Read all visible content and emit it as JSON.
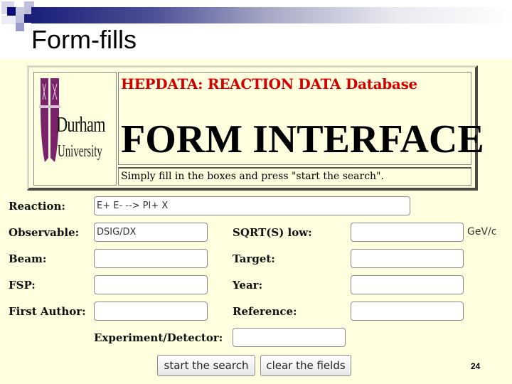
{
  "slide": {
    "title": "Form-fills",
    "page_number": "24",
    "colors": {
      "title_bar_start": "#1a1f7a",
      "background": "#ffffe0"
    }
  },
  "header": {
    "logo": {
      "icon": "durham-crest-icon",
      "name_line1": "Durham",
      "name_line2": "University",
      "crest_color": "#7b2369"
    },
    "database_title": "HEPDATA: REACTION DATA Database",
    "main_title": "FORM INTERFACE",
    "instructions": "Simply fill in the boxes and press \"start the search\".",
    "title_color": "#d40000"
  },
  "form": {
    "reaction": {
      "label": "Reaction:",
      "value": "E+ E- --> PI+ X"
    },
    "observable": {
      "label": "Observable:",
      "value": "DSIG/DX"
    },
    "sqrts_low": {
      "label": "SQRT(S) low:",
      "value": "",
      "unit": "GeV/c"
    },
    "beam": {
      "label": "Beam:",
      "value": ""
    },
    "target": {
      "label": "Target:",
      "value": ""
    },
    "fsp": {
      "label": "FSP:",
      "value": ""
    },
    "year": {
      "label": "Year:",
      "value": ""
    },
    "first_author": {
      "label": "First Author:",
      "value": ""
    },
    "reference": {
      "label": "Reference:",
      "value": ""
    },
    "experiment": {
      "label": "Experiment/Detector:",
      "value": ""
    },
    "search_button": "start the search",
    "clear_button": "clear the fields"
  }
}
